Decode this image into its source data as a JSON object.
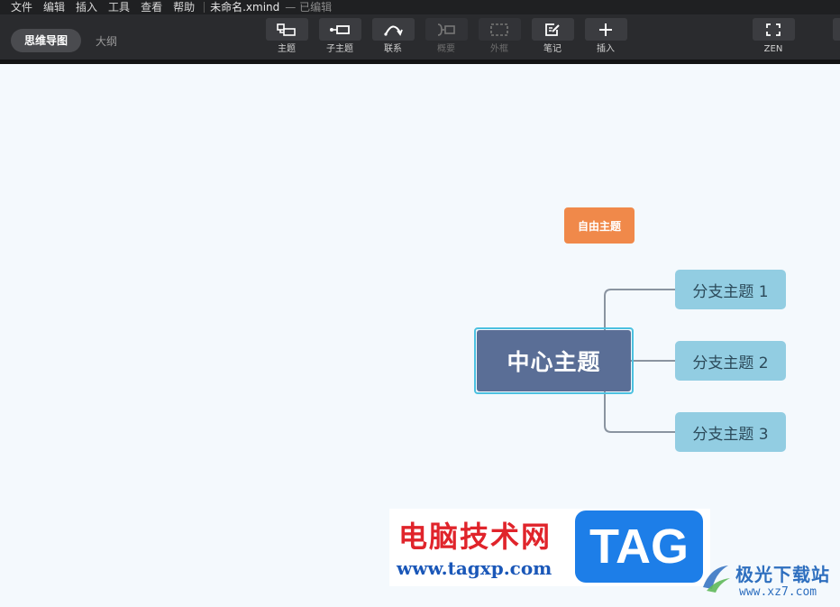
{
  "menubar": {
    "items": [
      "文件",
      "编辑",
      "插入",
      "工具",
      "查看",
      "帮助"
    ],
    "doc_title": "未命名.xmind",
    "doc_status": "— 已编辑"
  },
  "view_switch": {
    "mindmap_label": "思维导图",
    "outline_label": "大纲"
  },
  "toolbar": {
    "tools": [
      {
        "label": "主题",
        "icon": "topic-icon",
        "enabled": true
      },
      {
        "label": "子主题",
        "icon": "subtopic-icon",
        "enabled": true
      },
      {
        "label": "联系",
        "icon": "relationship-icon",
        "enabled": true
      },
      {
        "label": "概要",
        "icon": "summary-icon",
        "enabled": false
      },
      {
        "label": "外框",
        "icon": "boundary-icon",
        "enabled": false
      },
      {
        "label": "笔记",
        "icon": "note-icon",
        "enabled": true
      },
      {
        "label": "插入",
        "icon": "plus-icon",
        "enabled": true
      },
      {
        "label": "ZEN",
        "icon": "zen-fullscreen-icon",
        "enabled": true
      }
    ]
  },
  "mindmap": {
    "central_topic": "中心主题",
    "floating_topic": "自由主题",
    "branches": [
      "分支主题 1",
      "分支主题 2",
      "分支主题 3"
    ],
    "colors": {
      "central": "#5a6e96",
      "central_selection": "#4cc1e0",
      "branch": "#92cde2",
      "floating": "#f0894a",
      "connector": "#8a94a0",
      "canvas": "#f4f9fd"
    }
  },
  "watermarks": {
    "site_cn": "电脑技术网",
    "site_url": "www.tagxp.com",
    "tag_badge": "TAG",
    "right_name": "极光下载站",
    "right_url": "www.xz7.com"
  }
}
